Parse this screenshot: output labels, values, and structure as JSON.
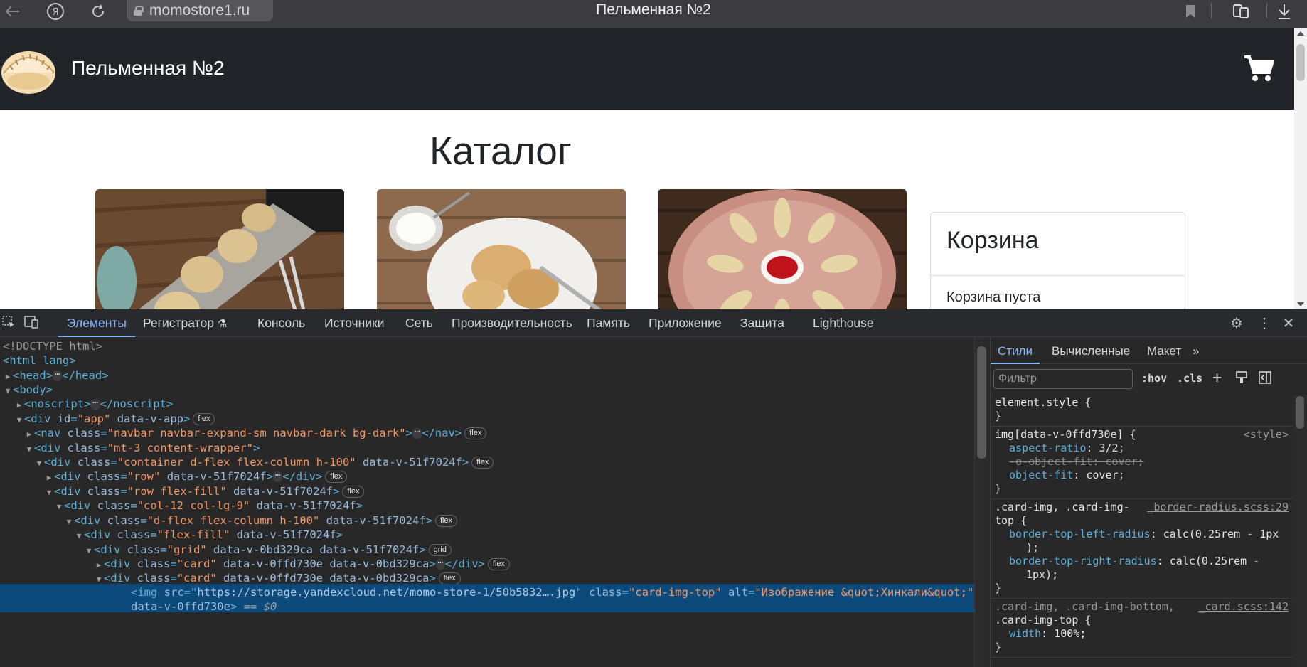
{
  "browser": {
    "url": "momostore1.ru",
    "tab_title": "Пельменная №2"
  },
  "site": {
    "brand": "Пельменная №2",
    "catalog_title": "Каталог",
    "cart_title": "Корзина",
    "cart_empty": "Корзина пуста"
  },
  "devtools": {
    "tabs": [
      "Элементы",
      "Регистратор",
      "Консоль",
      "Источники",
      "Сеть",
      "Производительность",
      "Память",
      "Приложение",
      "Защита",
      "Lighthouse"
    ],
    "styles_tabs": [
      "Стили",
      "Вычисленные",
      "Макет"
    ],
    "filter_placeholder": "Фильтр",
    "hov": ":hov",
    "cls": ".cls",
    "dom": {
      "doctype": "<!DOCTYPE html>",
      "html": "<html lang>",
      "head_open": "<head>",
      "head_close": "</head>",
      "body": "<body>",
      "noscript_open": "<noscript>",
      "noscript_close": "</noscript>",
      "app_tag": "<div ",
      "app_attr1": "id",
      "app_val1": "\"app\"",
      "app_attr2": " data-v-app",
      "nav_attr": "class",
      "nav_val": "\"navbar navbar-expand-sm navbar-dark bg-dark\"",
      "wrapper_val": "\"mt-3 content-wrapper\"",
      "container_val": "\"container d-flex flex-column h-100\"",
      "dv51": " data-v-51f7024f",
      "row_val": "\"row\"",
      "row_fill_val": "\"row flex-fill\"",
      "col_val": "\"col-12 col-lg-9\"",
      "dflex_val": "\"d-flex flex-column h-100\"",
      "flexfill_val": "\"flex-fill\"",
      "grid_val": "\"grid\"",
      "grid_attrs": " data-v-0bd329ca data-v-51f7024f",
      "card_val": "\"card\"",
      "card_attrs": " data-v-0ffd730e data-v-0bd329ca",
      "img_src_link": "https://storage.yandexcloud.net/momo-store-1/50b5832….jpg",
      "img_class_val": "\"card-img-top\"",
      "img_alt_val": "\"Изображение &quot;Хинкали&quot;\"",
      "img_data": "data-v-0ffd730e",
      "eq0": "== $0",
      "badge_flex": "flex",
      "badge_grid": "grid"
    },
    "styles": {
      "element_style": "element.style {",
      "close": "}",
      "r1_selector": "img[data-v-0ffd730e] {",
      "r1_source": "<style>",
      "r1_p1": "aspect-ratio",
      "r1_v1": "3/2;",
      "r1_p2": "-o-object-fit",
      "r1_v2": "cover;",
      "r1_p3": "object-fit",
      "r1_v3": "cover;",
      "r2_sel1": ".card-img, .card-img-",
      "r2_sel2": "top {",
      "r2_source": "_border-radius.scss:29",
      "r2_p1": "border-top-left-radius",
      "r2_v1": "calc(0.25rem - 1px",
      "r2_v1b": ");",
      "r2_p2": "border-top-right-radius",
      "r2_v2": "calc(0.25rem -",
      "r2_v2b": "1px);",
      "r3_sel1": ".card-img, .card-img-bottom,",
      "r3_sel2": ".card-img-top {",
      "r3_source": "_card.scss:142",
      "r3_p1": "width",
      "r3_v1": "100%;"
    }
  }
}
